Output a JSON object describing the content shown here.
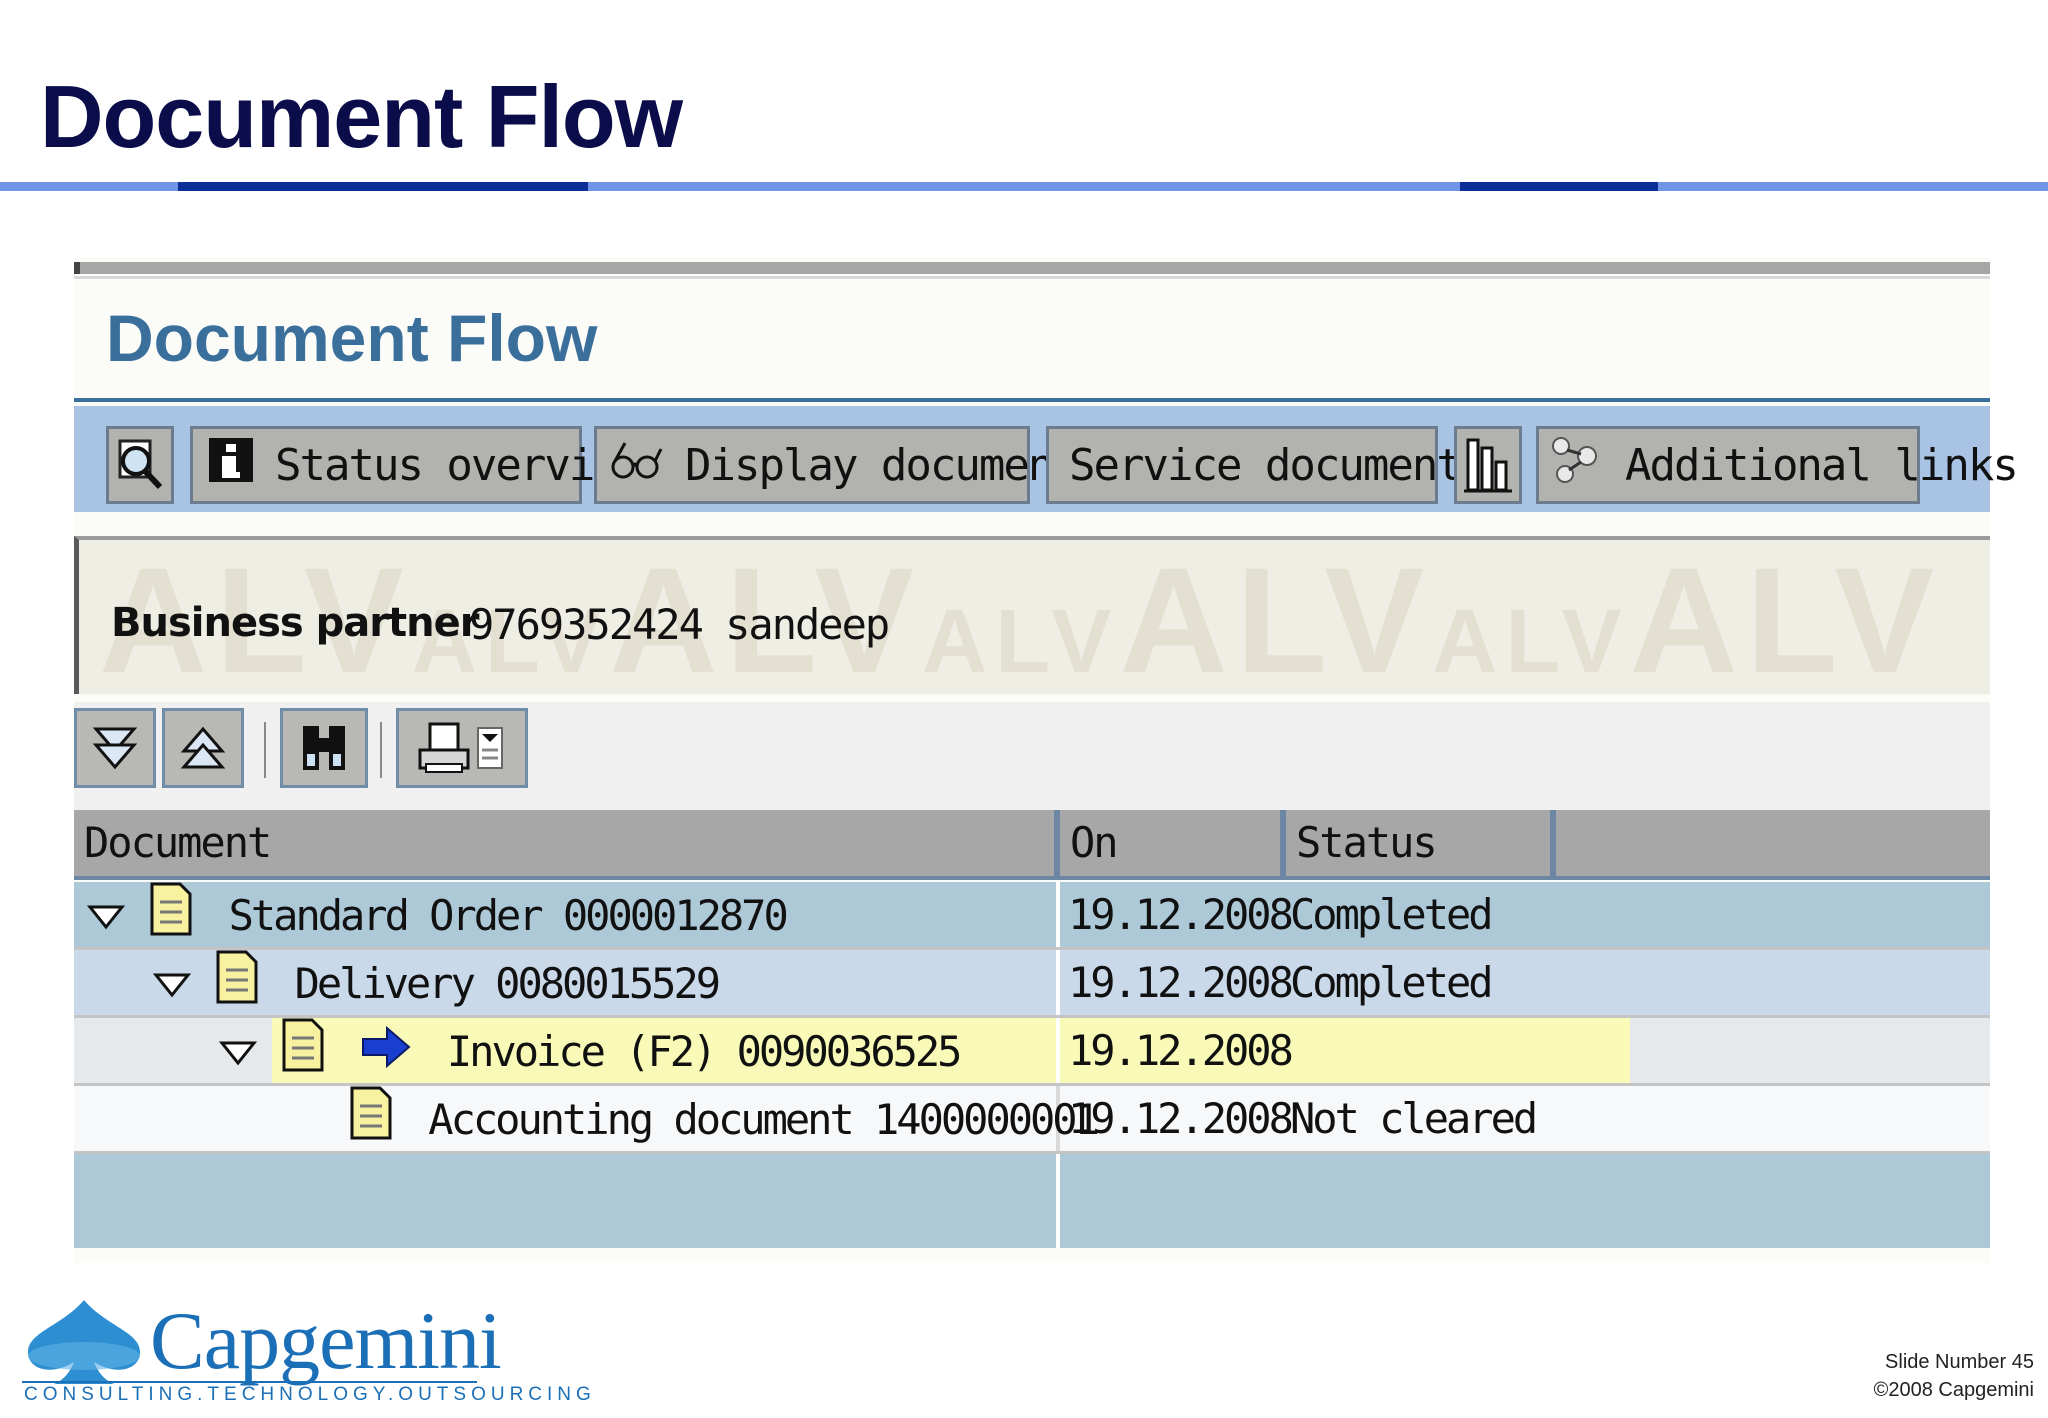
{
  "slide": {
    "title": "Document Flow",
    "footer": {
      "slide_number": "Slide Number 45",
      "copyright": "©2008 Capgemini"
    },
    "logo": {
      "name": "Capgemini",
      "tagline": "CONSULTING.TECHNOLOGY.OUTSOURCING"
    }
  },
  "sap": {
    "title": "Document Flow",
    "toolbar": {
      "status_overview": "Status overview",
      "display_document": "Display document",
      "service_documents": "Service documents",
      "additional_links": "Additional links"
    },
    "header": {
      "watermark": "ALV",
      "business_partner_label": "Business partner",
      "business_partner_value": "9769352424 sandeep"
    },
    "grid": {
      "columns": [
        "Document",
        "On",
        "Status",
        ""
      ],
      "rows": [
        {
          "document": "Standard Order 0000012870",
          "on": "19.12.2008",
          "status": "Completed"
        },
        {
          "document": "Delivery 0080015529",
          "on": "19.12.2008",
          "status": "Completed"
        },
        {
          "document": "Invoice (F2) 0090036525",
          "on": "19.12.2008",
          "status": ""
        },
        {
          "document": "Accounting document 1400000001",
          "on": "19.12.2008",
          "status": "Not cleared"
        }
      ]
    }
  },
  "colors": {
    "slide_title": "#0b0d4a",
    "sap_title": "#3a6f9c",
    "toolbar_bg": "#a9c3e4",
    "row_level1": "#adc9d8",
    "row_level2": "#c9d9ea",
    "row_selected": "#fafab8",
    "brand": "#1b6fb7"
  }
}
